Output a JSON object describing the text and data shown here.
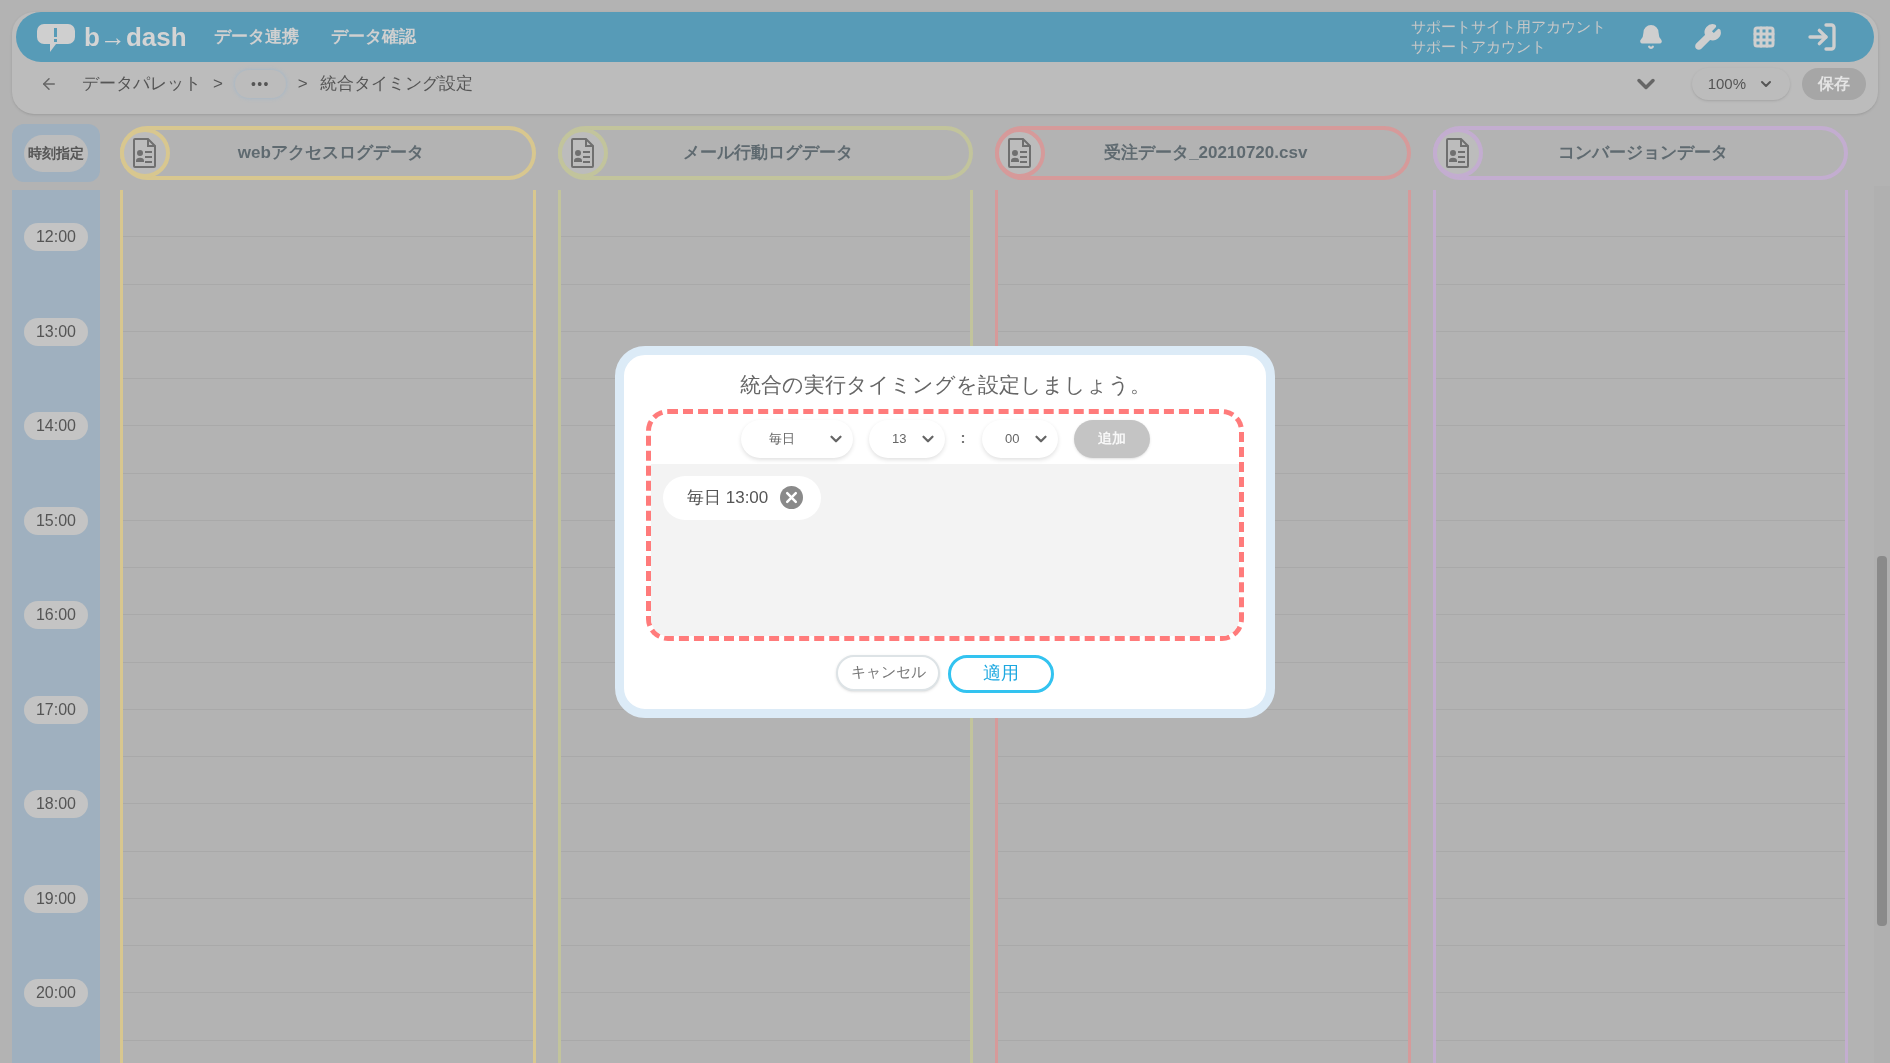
{
  "header": {
    "logo": "b→dash",
    "nav": [
      {
        "label": "データ連携"
      },
      {
        "label": "データ確認"
      }
    ],
    "account": [
      "サポートサイト用アカウント",
      "サポートアカウント"
    ]
  },
  "breadcrumb": {
    "items": [
      "データパレット",
      ">",
      "•••",
      ">",
      "統合タイミング設定"
    ],
    "zoom": "100%",
    "save": {
      "label": "保存",
      "disabled": true
    }
  },
  "timeline": {
    "axis_label": "時刻指定",
    "columns": [
      {
        "name": "webアクセスログデータ",
        "color": "#d8c78f"
      },
      {
        "name": "メール行動ログデータ",
        "color": "#c2c49c"
      },
      {
        "name": "受注データ_20210720.csv",
        "color": "#d69a9a"
      },
      {
        "name": "コンバージョンデータ",
        "color": "#c3add0"
      }
    ],
    "times": [
      "12:00",
      "13:00",
      "14:00",
      "15:00",
      "16:00",
      "17:00",
      "18:00",
      "19:00",
      "20:00"
    ]
  },
  "dialog": {
    "title": "統合の実行タイミングを設定しましょう。",
    "frequency": "毎日",
    "hour": "13",
    "separator": ":",
    "minute": "00",
    "add": {
      "label": "追加",
      "disabled": true
    },
    "schedules": [
      {
        "label": "毎日 13:00"
      }
    ],
    "cancel": "キャンセル",
    "apply": "適用"
  }
}
